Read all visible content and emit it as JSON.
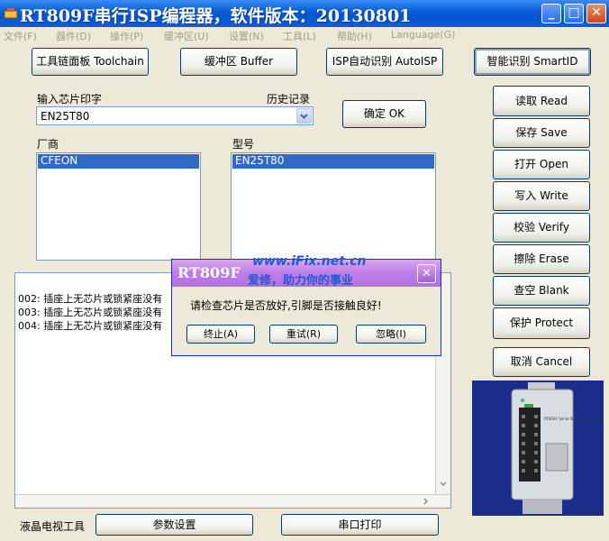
{
  "window": {
    "title": "RT809F串行ISP编程器，软件版本：20130801",
    "controls": [
      "_",
      "□",
      "✕"
    ]
  },
  "menu": [
    "文件(F)",
    "器件(D)",
    "操作(P)",
    "缓冲区(U)",
    "设置(N)",
    "工具(L)",
    "帮助(H)",
    "Language(G)"
  ],
  "toolbar": {
    "toolchain": "工具链面板 Toolchain",
    "buffer": "缓冲区 Buffer",
    "autoisp": "ISP自动识别 AutoISP",
    "smartid": "智能识别 SmartID"
  },
  "chip": {
    "mark_label": "输入芯片印字",
    "history_label": "历史记录",
    "mark_value": "EN25T80",
    "ok_button": "确定 OK",
    "vendor_label": "厂商",
    "vendor_selected": "CFEON",
    "model_label": "型号",
    "model_selected": "EN25T80"
  },
  "actions": {
    "read": "读取 Read",
    "save": "保存 Save",
    "open": "打开 Open",
    "write": "写入 Write",
    "verify": "校验 Verify",
    "erase": "擦除 Erase",
    "blank": "查空 Blank",
    "protect": "保护 Protect",
    "cancel": "取消 Cancel"
  },
  "log": [
    "002: 插座上无芯片或锁紧座没有",
    "003: 插座上无芯片或锁紧座没有",
    "004: 插座上无芯片或锁紧座没有"
  ],
  "bottom": {
    "lcd_label": "液晶电视工具",
    "params_button": "参数设置",
    "serial_print_button": "串口打印"
  },
  "dialog": {
    "title": "RT809F",
    "message": "请检查芯片是否放好,引脚是否接触良好!",
    "abort": "终止(A)",
    "retry": "重试(R)",
    "ignore": "忽略(I)"
  },
  "watermark": {
    "url": "www.iFix.net.cn",
    "slogan": "爱修，助力你的事业"
  },
  "photo": {
    "device_caption": "RT809F Serial ISP Programmer"
  },
  "colors": {
    "title_blue": "#0a5fd8",
    "selection": "#316ac5",
    "dialog_title": "#c080e8"
  }
}
